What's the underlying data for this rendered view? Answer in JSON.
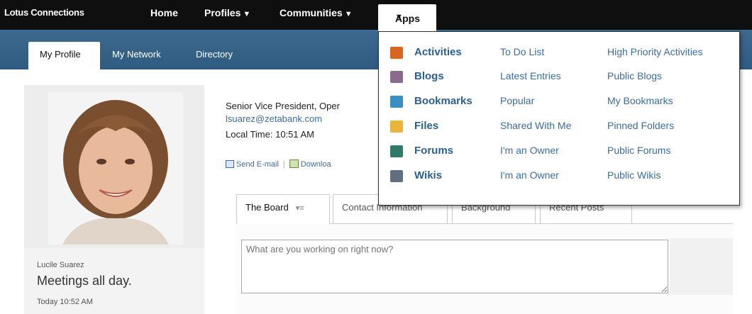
{
  "topbar": {
    "brand": "Lotus Connections",
    "nav": [
      {
        "label": "Home",
        "caret": ""
      },
      {
        "label": "Profiles",
        "caret": "▼"
      },
      {
        "label": "Communities",
        "caret": "▼"
      }
    ],
    "apps": {
      "label": "Apps",
      "caret": "▼"
    }
  },
  "tabs": [
    "My Profile",
    "My Network",
    "Directory"
  ],
  "profile": {
    "job_title": "Senior Vice President, Oper",
    "email": "lsuarez@zetabank.com",
    "local_time": "Local Time: 10:51 AM",
    "actions": {
      "send_email": "Send E-mail",
      "download": "Downloa"
    },
    "name": "Lucile Suarez",
    "status": "Meetings all day.",
    "status_time": "Today 10:52 AM"
  },
  "profile_tabs": [
    {
      "label": "The Board",
      "icon": "menu-icon"
    },
    {
      "label": "Contact Information"
    },
    {
      "label": "Background"
    },
    {
      "label": "Recent Posts"
    }
  ],
  "post": {
    "placeholder": "What are you working on right now?"
  },
  "apps_menu": [
    {
      "icon": "activities-icon",
      "color": "#d9661e",
      "name": "Activities",
      "link1": "To Do List",
      "link2": "High Priority Activities"
    },
    {
      "icon": "blogs-icon",
      "color": "#8b6b8b",
      "name": "Blogs",
      "link1": "Latest Entries",
      "link2": "Public Blogs"
    },
    {
      "icon": "bookmarks-icon",
      "color": "#3a8fc2",
      "name": "Bookmarks",
      "link1": "Popular",
      "link2": "My Bookmarks"
    },
    {
      "icon": "folder-icon",
      "color": "#e8b53a",
      "name": "Files",
      "link1": "Shared With Me",
      "link2": "Pinned Folders"
    },
    {
      "icon": "forums-icon",
      "color": "#2f7a6a",
      "name": "Forums",
      "link1": "I'm an Owner",
      "link2": "Public Forums"
    },
    {
      "icon": "wikis-icon",
      "color": "#5f6f7f",
      "name": "Wikis",
      "link1": "I'm an Owner",
      "link2": "Public Wikis"
    }
  ]
}
